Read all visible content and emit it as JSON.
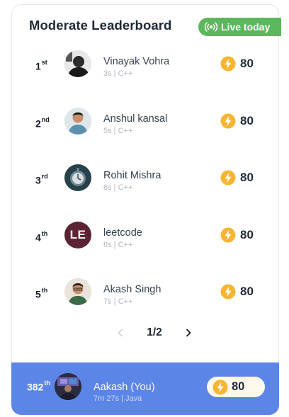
{
  "header": {
    "title": "Moderate Leaderboard",
    "live_label": "Live today",
    "live_color": "#5cb85c"
  },
  "leaderboard": [
    {
      "rank": "1",
      "suffix": "st",
      "name": "Vinayak Vohra",
      "meta": "3s | C++",
      "score": "80",
      "avatar": "photo"
    },
    {
      "rank": "2",
      "suffix": "nd",
      "name": "Anshul kansal",
      "meta": "5s | C++",
      "score": "80",
      "avatar": "photo"
    },
    {
      "rank": "3",
      "suffix": "rd",
      "name": "Rohit Mishra",
      "meta": "6s | C++",
      "score": "80",
      "avatar": "photo"
    },
    {
      "rank": "4",
      "suffix": "th",
      "name": "leetcode",
      "meta": "6s | C++",
      "score": "80",
      "avatar": "initials",
      "initials": "LE"
    },
    {
      "rank": "5",
      "suffix": "th",
      "name": "Akash Singh",
      "meta": "7s | C++",
      "score": "80",
      "avatar": "photo"
    }
  ],
  "pagination": {
    "label": "1/2",
    "prev_icon": "chevron-left-icon",
    "next_icon": "chevron-right-icon"
  },
  "current_user": {
    "rank": "382",
    "suffix": "th",
    "name": "Aakash (You)",
    "meta": "7m 27s | Java",
    "score": "80",
    "bar_color": "#5b85e6"
  },
  "icons": {
    "score": "lightning-bolt-icon",
    "live": "broadcast-icon"
  }
}
